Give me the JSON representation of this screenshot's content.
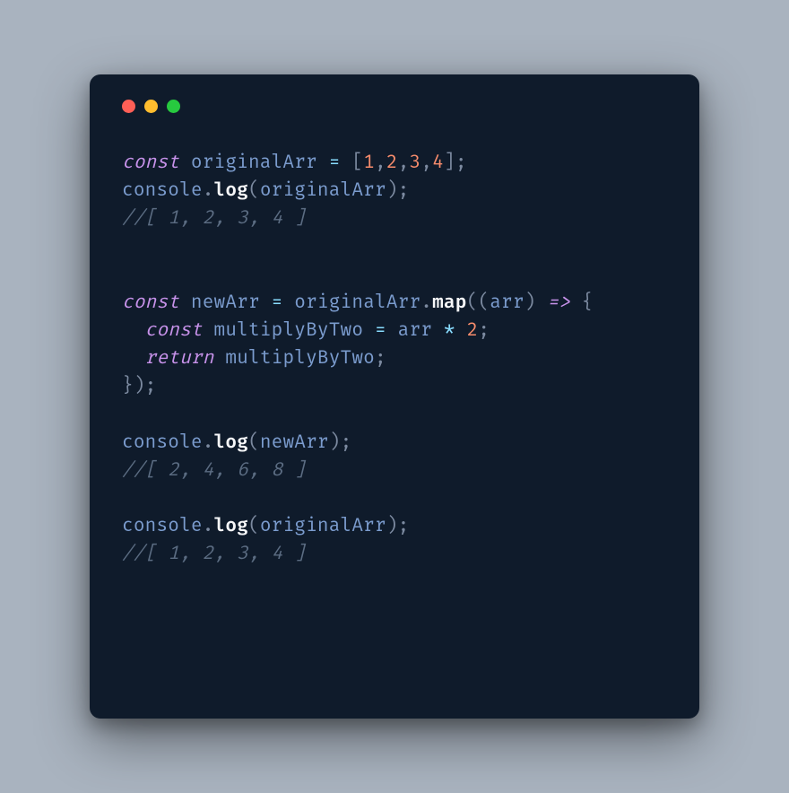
{
  "colors": {
    "close": "#ff5f56",
    "minimize": "#ffbd2e",
    "maximize": "#27c93f",
    "background": "#0f1b2b",
    "page": "#a9b3bf"
  },
  "code": {
    "line1": {
      "kw": "const",
      "sp1": " ",
      "var": "originalArr",
      "sp2": " ",
      "eq": "=",
      "sp3": " ",
      "lb": "[",
      "n1": "1",
      "c1": ",",
      "n2": "2",
      "c2": ",",
      "n3": "3",
      "c3": ",",
      "n4": "4",
      "rb": "]",
      "semi": ";"
    },
    "line2": {
      "console": "console",
      "dot": ".",
      "method": "log",
      "lp": "(",
      "arg": "originalArr",
      "rp": ")",
      "semi": ";"
    },
    "line3": {
      "comment": "//[ 1, 2, 3, 4 ]"
    },
    "line4": {
      "kw": "const",
      "sp1": " ",
      "var": "newArr",
      "sp2": " ",
      "eq": "=",
      "sp3": " ",
      "obj": "originalArr",
      "dot": ".",
      "method": "map",
      "lp": "(",
      "lp2": "(",
      "param": "arr",
      "rp2": ")",
      "sp4": " ",
      "arrow": "=>",
      "sp5": " ",
      "lb": "{"
    },
    "line5": {
      "indent": "  ",
      "kw": "const",
      "sp1": " ",
      "var": "multiplyByTwo",
      "sp2": " ",
      "eq": "=",
      "sp3": " ",
      "arg": "arr",
      "sp4": " ",
      "star": "*",
      "sp5": " ",
      "num": "2",
      "semi": ";"
    },
    "line6": {
      "indent": "  ",
      "kw": "return",
      "sp1": " ",
      "var": "multiplyByTwo",
      "semi": ";"
    },
    "line7": {
      "rb": "}",
      "rp": ")",
      "semi": ";"
    },
    "line8": {
      "console": "console",
      "dot": ".",
      "method": "log",
      "lp": "(",
      "arg": "newArr",
      "rp": ")",
      "semi": ";"
    },
    "line9": {
      "comment": "//[ 2, 4, 6, 8 ]"
    },
    "line10": {
      "console": "console",
      "dot": ".",
      "method": "log",
      "lp": "(",
      "arg": "originalArr",
      "rp": ")",
      "semi": ";"
    },
    "line11": {
      "comment": "//[ 1, 2, 3, 4 ]"
    }
  }
}
